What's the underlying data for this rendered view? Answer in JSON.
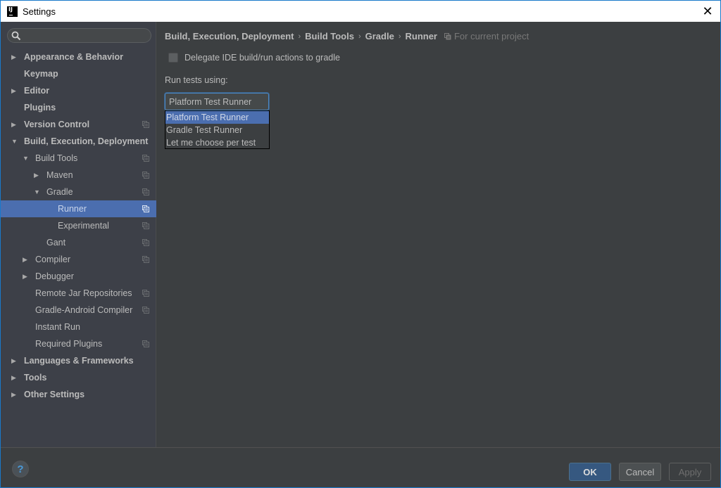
{
  "window": {
    "title": "Settings",
    "app_icon_text": "IJ",
    "close_glyph": "✕"
  },
  "sidebar": {
    "search": {
      "value": "",
      "placeholder": ""
    },
    "items": [
      {
        "label": "Appearance & Behavior",
        "level": 0,
        "arrow": "right",
        "bold": true,
        "project_icon": false,
        "selected": false
      },
      {
        "label": "Keymap",
        "level": 0,
        "arrow": "none",
        "bold": true,
        "project_icon": false,
        "selected": false
      },
      {
        "label": "Editor",
        "level": 0,
        "arrow": "right",
        "bold": true,
        "project_icon": false,
        "selected": false
      },
      {
        "label": "Plugins",
        "level": 0,
        "arrow": "none",
        "bold": true,
        "project_icon": false,
        "selected": false
      },
      {
        "label": "Version Control",
        "level": 0,
        "arrow": "right",
        "bold": true,
        "project_icon": true,
        "selected": false
      },
      {
        "label": "Build, Execution, Deployment",
        "level": 0,
        "arrow": "down",
        "bold": true,
        "project_icon": false,
        "selected": false
      },
      {
        "label": "Build Tools",
        "level": 1,
        "arrow": "down",
        "bold": false,
        "project_icon": true,
        "selected": false
      },
      {
        "label": "Maven",
        "level": 2,
        "arrow": "right",
        "bold": false,
        "project_icon": true,
        "selected": false
      },
      {
        "label": "Gradle",
        "level": 2,
        "arrow": "down",
        "bold": false,
        "project_icon": true,
        "selected": false
      },
      {
        "label": "Runner",
        "level": 3,
        "arrow": "none",
        "bold": false,
        "project_icon": true,
        "selected": true
      },
      {
        "label": "Experimental",
        "level": 3,
        "arrow": "none",
        "bold": false,
        "project_icon": true,
        "selected": false
      },
      {
        "label": "Gant",
        "level": 2,
        "arrow": "none",
        "bold": false,
        "project_icon": true,
        "selected": false
      },
      {
        "label": "Compiler",
        "level": 1,
        "arrow": "right",
        "bold": false,
        "project_icon": true,
        "selected": false
      },
      {
        "label": "Debugger",
        "level": 1,
        "arrow": "right",
        "bold": false,
        "project_icon": false,
        "selected": false
      },
      {
        "label": "Remote Jar Repositories",
        "level": 1,
        "arrow": "none",
        "bold": false,
        "project_icon": true,
        "selected": false
      },
      {
        "label": "Gradle-Android Compiler",
        "level": 1,
        "arrow": "none",
        "bold": false,
        "project_icon": true,
        "selected": false
      },
      {
        "label": "Instant Run",
        "level": 1,
        "arrow": "none",
        "bold": false,
        "project_icon": false,
        "selected": false
      },
      {
        "label": "Required Plugins",
        "level": 1,
        "arrow": "none",
        "bold": false,
        "project_icon": true,
        "selected": false
      },
      {
        "label": "Languages & Frameworks",
        "level": 0,
        "arrow": "right",
        "bold": true,
        "project_icon": false,
        "selected": false
      },
      {
        "label": "Tools",
        "level": 0,
        "arrow": "right",
        "bold": true,
        "project_icon": false,
        "selected": false
      },
      {
        "label": "Other Settings",
        "level": 0,
        "arrow": "right",
        "bold": true,
        "project_icon": false,
        "selected": false
      }
    ]
  },
  "content": {
    "breadcrumb": [
      "Build, Execution, Deployment",
      "Build Tools",
      "Gradle",
      "Runner"
    ],
    "breadcrumb_separator": "›",
    "scope_label": "For current project",
    "delegate_checkbox": {
      "label": "Delegate IDE build/run actions to gradle",
      "checked": false
    },
    "run_tests_label": "Run tests using:",
    "run_tests_combo": {
      "value": "Platform Test Runner",
      "arrow": "▼",
      "options": [
        "Platform Test Runner",
        "Gradle Test Runner",
        "Let me choose per test"
      ],
      "highlighted_index": 0
    }
  },
  "footer": {
    "help_glyph": "?",
    "ok_label": "OK",
    "cancel_label": "Cancel",
    "apply_label": "Apply"
  },
  "colors": {
    "accent_border": "#1979ca",
    "selection": "#4b6eaf",
    "sidebar_bg": "#3d4048",
    "content_bg": "#3c3f41",
    "ok_button": "#365880"
  }
}
